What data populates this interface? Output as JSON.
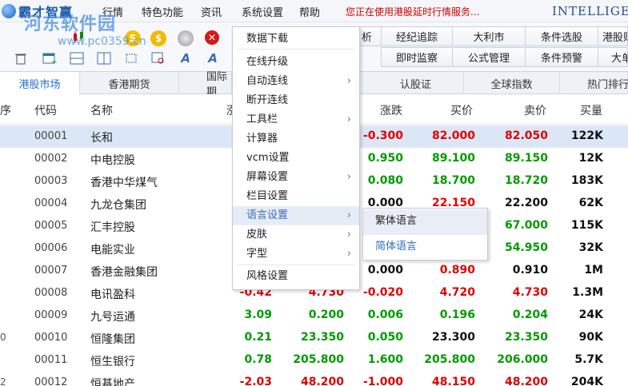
{
  "menubar": {
    "app_name": "霸才智赢",
    "items": [
      "行情",
      "特色功能",
      "资讯",
      "系统设置",
      "帮助"
    ],
    "notice": "您正在使用港股延时行情服务...",
    "brand": "INTELLIGEN"
  },
  "watermark": {
    "text": "河东软件园",
    "url": "www.pc0359.cn"
  },
  "toolbar": {
    "icons_row1": [
      "candle-chart-icon",
      "coin-s-icon",
      "coin-dollar-icon",
      "disc-icon",
      "close-red-icon"
    ],
    "icons_row2": [
      "trash-icon",
      "add-window-icon",
      "split-h-icon",
      "split-v-icon",
      "crop-icon",
      "zoom-window-icon",
      "font-a-icon",
      "font-a-alt-icon"
    ],
    "quick_buttons_row1": [
      "析",
      "经纪追踪",
      "大利市",
      "条件选股",
      "港股财"
    ],
    "quick_buttons_row2": [
      "即时监察",
      "公式管理",
      "条件预警",
      "大单"
    ]
  },
  "tabs": [
    "港股市场",
    "香港期货",
    "国际期",
    "认股证",
    "全球指数",
    "热门排行"
  ],
  "table": {
    "headers": [
      "代码",
      "名称",
      "涨",
      "涨跌",
      "买价",
      "卖价",
      "买量"
    ],
    "rows": [
      {
        "edge": "",
        "code": "00001",
        "name": "长和",
        "pct": "",
        "last": "",
        "chg": "-0.300",
        "bid": "82.000",
        "ask": "82.050",
        "vol": "122K",
        "c_pct": "down",
        "c_last": "down",
        "c_chg": "down",
        "c_bid": "down",
        "c_ask": "down"
      },
      {
        "edge": "",
        "code": "00002",
        "name": "中电控股",
        "pct": "",
        "last": "",
        "chg": "0.950",
        "bid": "89.100",
        "ask": "89.150",
        "vol": "12K",
        "c_pct": "up",
        "c_last": "up",
        "c_chg": "up",
        "c_bid": "up",
        "c_ask": "up"
      },
      {
        "edge": "",
        "code": "00003",
        "name": "香港中华煤气",
        "pct": "",
        "last": "",
        "chg": "0.080",
        "bid": "18.700",
        "ask": "18.720",
        "vol": "183K",
        "c_pct": "up",
        "c_last": "up",
        "c_chg": "up",
        "c_bid": "up",
        "c_ask": "up"
      },
      {
        "edge": "",
        "code": "00004",
        "name": "九龙仓集团",
        "pct": "",
        "last": "",
        "chg": "0.000",
        "bid": "22.150",
        "ask": "22.200",
        "vol": "62K",
        "c_pct": "flat",
        "c_last": "flat",
        "c_chg": "flat",
        "c_bid": "down",
        "c_ask": "flat"
      },
      {
        "edge": "",
        "code": "00005",
        "name": "汇丰控股",
        "pct": "",
        "last": "",
        "chg": "",
        "bid": "",
        "ask": "67.000",
        "vol": "115K",
        "c_pct": "up",
        "c_last": "up",
        "c_chg": "up",
        "c_bid": "up",
        "c_ask": "up"
      },
      {
        "edge": "",
        "code": "00006",
        "name": "电能实业",
        "pct": "",
        "last": "",
        "chg": "",
        "bid": "",
        "ask": "54.950",
        "vol": "32K",
        "c_pct": "up",
        "c_last": "up",
        "c_chg": "up",
        "c_bid": "up",
        "c_ask": "up"
      },
      {
        "edge": "",
        "code": "00007",
        "name": "香港金融集团",
        "pct": "",
        "last": "",
        "chg": "0.000",
        "bid": "0.890",
        "ask": "0.910",
        "vol": "1M",
        "c_pct": "flat",
        "c_last": "flat",
        "c_chg": "flat",
        "c_bid": "down",
        "c_ask": "flat"
      },
      {
        "edge": "",
        "code": "00008",
        "name": "电讯盈科",
        "pct": "-0.42",
        "last": "4.730",
        "chg": "-0.020",
        "bid": "4.720",
        "ask": "4.730",
        "vol": "1.3M",
        "c_pct": "down",
        "c_last": "down",
        "c_chg": "down",
        "c_bid": "down",
        "c_ask": "down"
      },
      {
        "edge": "",
        "code": "00009",
        "name": "九号运通",
        "pct": "3.09",
        "last": "0.200",
        "chg": "0.006",
        "bid": "0.196",
        "ask": "0.204",
        "vol": "24K",
        "c_pct": "up",
        "c_last": "up",
        "c_chg": "up",
        "c_bid": "up",
        "c_ask": "up"
      },
      {
        "edge": "0",
        "code": "00010",
        "name": "恒隆集团",
        "pct": "0.21",
        "last": "23.350",
        "chg": "0.050",
        "bid": "23.300",
        "ask": "23.350",
        "vol": "90K",
        "c_pct": "up",
        "c_last": "up",
        "c_chg": "up",
        "c_bid": "flat",
        "c_ask": "up"
      },
      {
        "edge": "",
        "code": "00011",
        "name": "恒生银行",
        "pct": "0.78",
        "last": "205.800",
        "chg": "1.600",
        "bid": "205.800",
        "ask": "206.000",
        "vol": "5.7K",
        "c_pct": "up",
        "c_last": "up",
        "c_chg": "up",
        "c_bid": "up",
        "c_ask": "up"
      },
      {
        "edge": "2",
        "code": "00012",
        "name": "恒基地产",
        "pct": "-2.03",
        "last": "48.200",
        "chg": "-1.000",
        "bid": "48.150",
        "ask": "48.200",
        "vol": "204K",
        "c_pct": "down",
        "c_last": "down",
        "c_chg": "down",
        "c_bid": "down",
        "c_ask": "down"
      }
    ]
  },
  "system_menu": {
    "items": [
      {
        "label": "数据下载",
        "arrow": ""
      },
      {
        "label": "在线升级",
        "arrow": ""
      },
      {
        "label": "自动连线",
        "arrow": "›"
      },
      {
        "label": "断开连线",
        "arrow": ""
      },
      {
        "label": "工具栏",
        "arrow": "›"
      },
      {
        "label": "计算器",
        "arrow": ""
      },
      {
        "label": "vcm设置",
        "arrow": ""
      },
      {
        "label": "屏幕设置",
        "arrow": "›"
      },
      {
        "label": "栏目设置",
        "arrow": ""
      },
      {
        "label": "语言设置",
        "arrow": "›"
      },
      {
        "label": "皮肤",
        "arrow": "›"
      },
      {
        "label": "字型",
        "arrow": "›"
      },
      {
        "label": "风格设置",
        "arrow": ""
      }
    ]
  },
  "language_menu": {
    "items": [
      "繁体语言",
      "简体语言"
    ]
  },
  "colors": {
    "up": "#009a00",
    "down": "#e00000",
    "accent": "#1f6fd1"
  }
}
